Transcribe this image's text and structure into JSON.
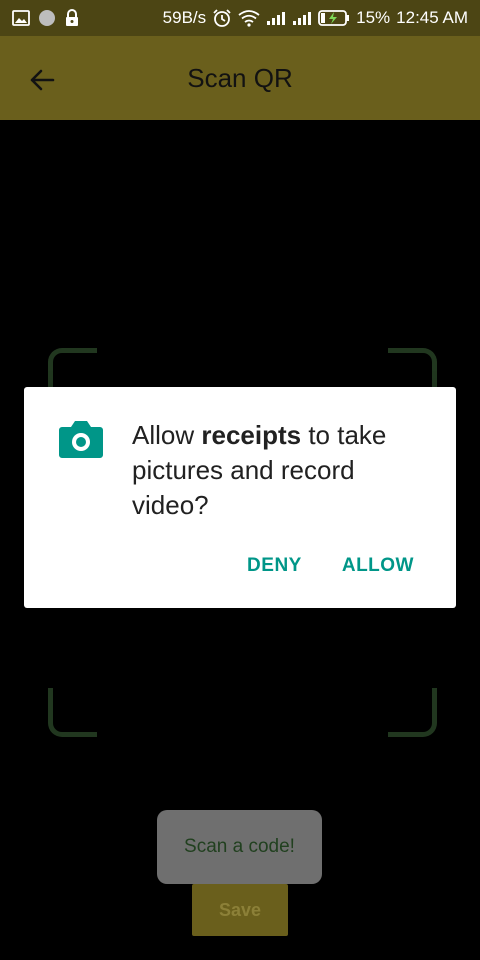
{
  "status_bar": {
    "net_speed": "59B/s",
    "battery_percent": "15%",
    "time": "12:45 AM",
    "icons": [
      "image-icon",
      "circle-icon",
      "lock-icon",
      "alarm-icon",
      "wifi-icon",
      "signal-icon",
      "signal-icon",
      "battery-charging-icon"
    ]
  },
  "app_bar": {
    "title": "Scan QR",
    "back_icon": "arrow-back-icon"
  },
  "dialog": {
    "message_prefix": "Allow ",
    "app_name": "receipts",
    "message_suffix": " to take pictures and record video?",
    "icon": "camera-icon",
    "deny_label": "DENY",
    "allow_label": "ALLOW"
  },
  "toast": {
    "text": "Scan a code!"
  },
  "save_button": {
    "label": "Save"
  },
  "colors": {
    "status_bar_bg": "#4c4514",
    "app_bar_bg": "#6a5f1c",
    "accent": "#009688",
    "frame_corners": "#21371f"
  }
}
